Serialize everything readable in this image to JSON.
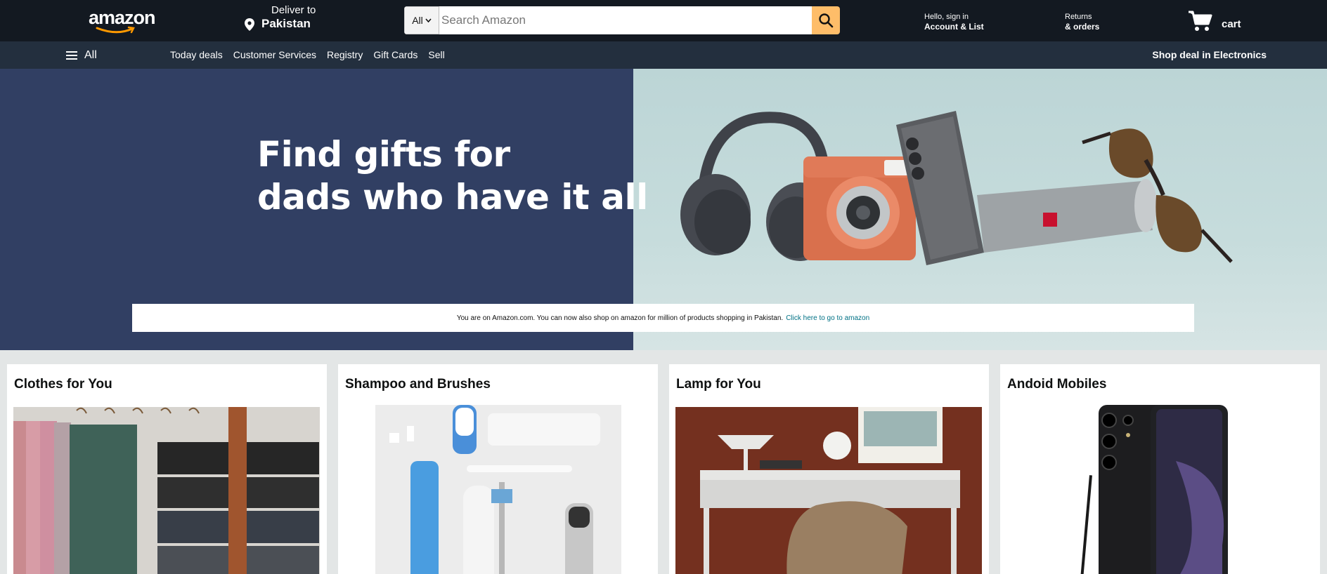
{
  "header": {
    "logo_text": "amazon",
    "deliver_label": "Deliver to",
    "deliver_location": "Pakistan",
    "search_category": "All",
    "search_placeholder": "Search Amazon",
    "account_greeting": "Hello, sign in",
    "account_label": "Account & List",
    "returns_label": "Returns",
    "orders_label": "& orders",
    "cart_label": "cart"
  },
  "subnav": {
    "all_label": "All",
    "links": [
      "Today deals",
      "Customer Services",
      "Registry",
      "Gift Cards",
      "Sell"
    ],
    "promo": "Shop deal in Electronics"
  },
  "hero": {
    "headline_line1": "Find gifts for",
    "headline_line2": "dads who have it all",
    "notice_text": "You are on Amazon.com. You can now also shop on amazon for million of products shopping in Pakistan.",
    "notice_link": "Click here to go to amazon",
    "colors": {
      "left_bg": "#313f63",
      "right_bg": "#c2d8d9"
    }
  },
  "cards": [
    {
      "title": "Clothes for You",
      "image": "clothes-hanger-photo"
    },
    {
      "title": "Shampoo and Brushes",
      "image": "toiletries-photo"
    },
    {
      "title": "Lamp for You",
      "image": "desk-lamp-room-photo"
    },
    {
      "title": "Andoid Mobiles",
      "image": "android-phone-photo"
    }
  ],
  "colors": {
    "nav_bg": "#131921",
    "subnav_bg": "#232f3e",
    "search_button": "#febd69",
    "link": "#007185",
    "page_bg": "#e3e6e6"
  }
}
